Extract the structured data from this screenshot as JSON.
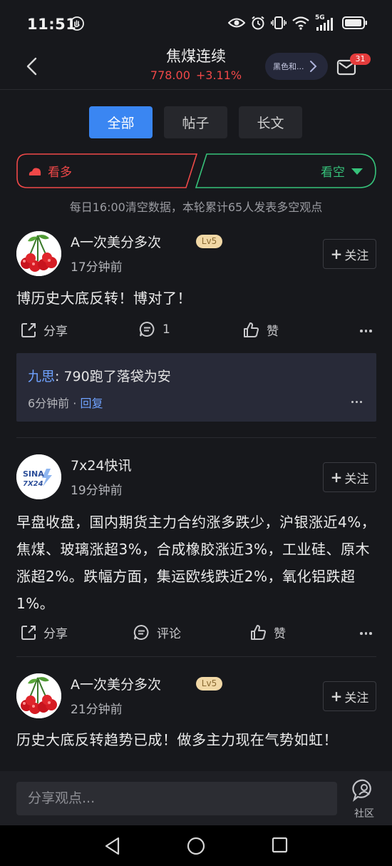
{
  "status_bar": {
    "time": "11:51",
    "network": "5G"
  },
  "header": {
    "title": "焦煤连续",
    "price": "778.00",
    "change_pct": "+3.11%",
    "related_pill": "黑色和...",
    "mail_badge": "31",
    "price_color": "#f04848"
  },
  "tabs": [
    {
      "label": "全部",
      "active": true
    },
    {
      "label": "帖子",
      "active": false
    },
    {
      "label": "长文",
      "active": false
    }
  ],
  "vote": {
    "bull_label": "看多",
    "bear_label": "看空",
    "note": "每日16:00清空数据，本轮累计65人发表多空观点",
    "bull_color": "#ef4848",
    "bear_color": "#36c27a"
  },
  "posts": [
    {
      "author": "A一次美分多次",
      "level": "Lv5",
      "time": "17分钟前",
      "follow_label": "关注",
      "avatar_icon": "cherries-icon",
      "content": "博历史大底反转！博对了！",
      "actions": {
        "share": "分享",
        "comment": "1",
        "like": "赞"
      },
      "reply": {
        "name": "九思",
        "sep": ": ",
        "text": "790跑了落袋为安",
        "time": "6分钟前",
        "dot": " · ",
        "reply_label": "回复"
      }
    },
    {
      "author": "7x24快讯",
      "time": "19分钟前",
      "follow_label": "关注",
      "avatar_icon": "sina-7x24-logo-icon",
      "avatar_text_1": "SINA",
      "avatar_text_2": "7X24",
      "content": "早盘收盘，国内期货主力合约涨多跌少，沪银涨近4%，焦煤、玻璃涨超3%，合成橡胶涨近3%，工业硅、原木涨超2%。跌幅方面，集运欧线跌近2%，氧化铝跌超1%。",
      "actions": {
        "share": "分享",
        "comment": "评论",
        "like": "赞"
      }
    },
    {
      "author": "A一次美分多次",
      "level": "Lv5",
      "time": "21分钟前",
      "follow_label": "关注",
      "avatar_icon": "cherries-icon",
      "content": "历史大底反转趋势已成！做多主力现在气势如虹！"
    }
  ],
  "bottom_bar": {
    "input_placeholder": "分享观点...",
    "community_label": "社区"
  }
}
